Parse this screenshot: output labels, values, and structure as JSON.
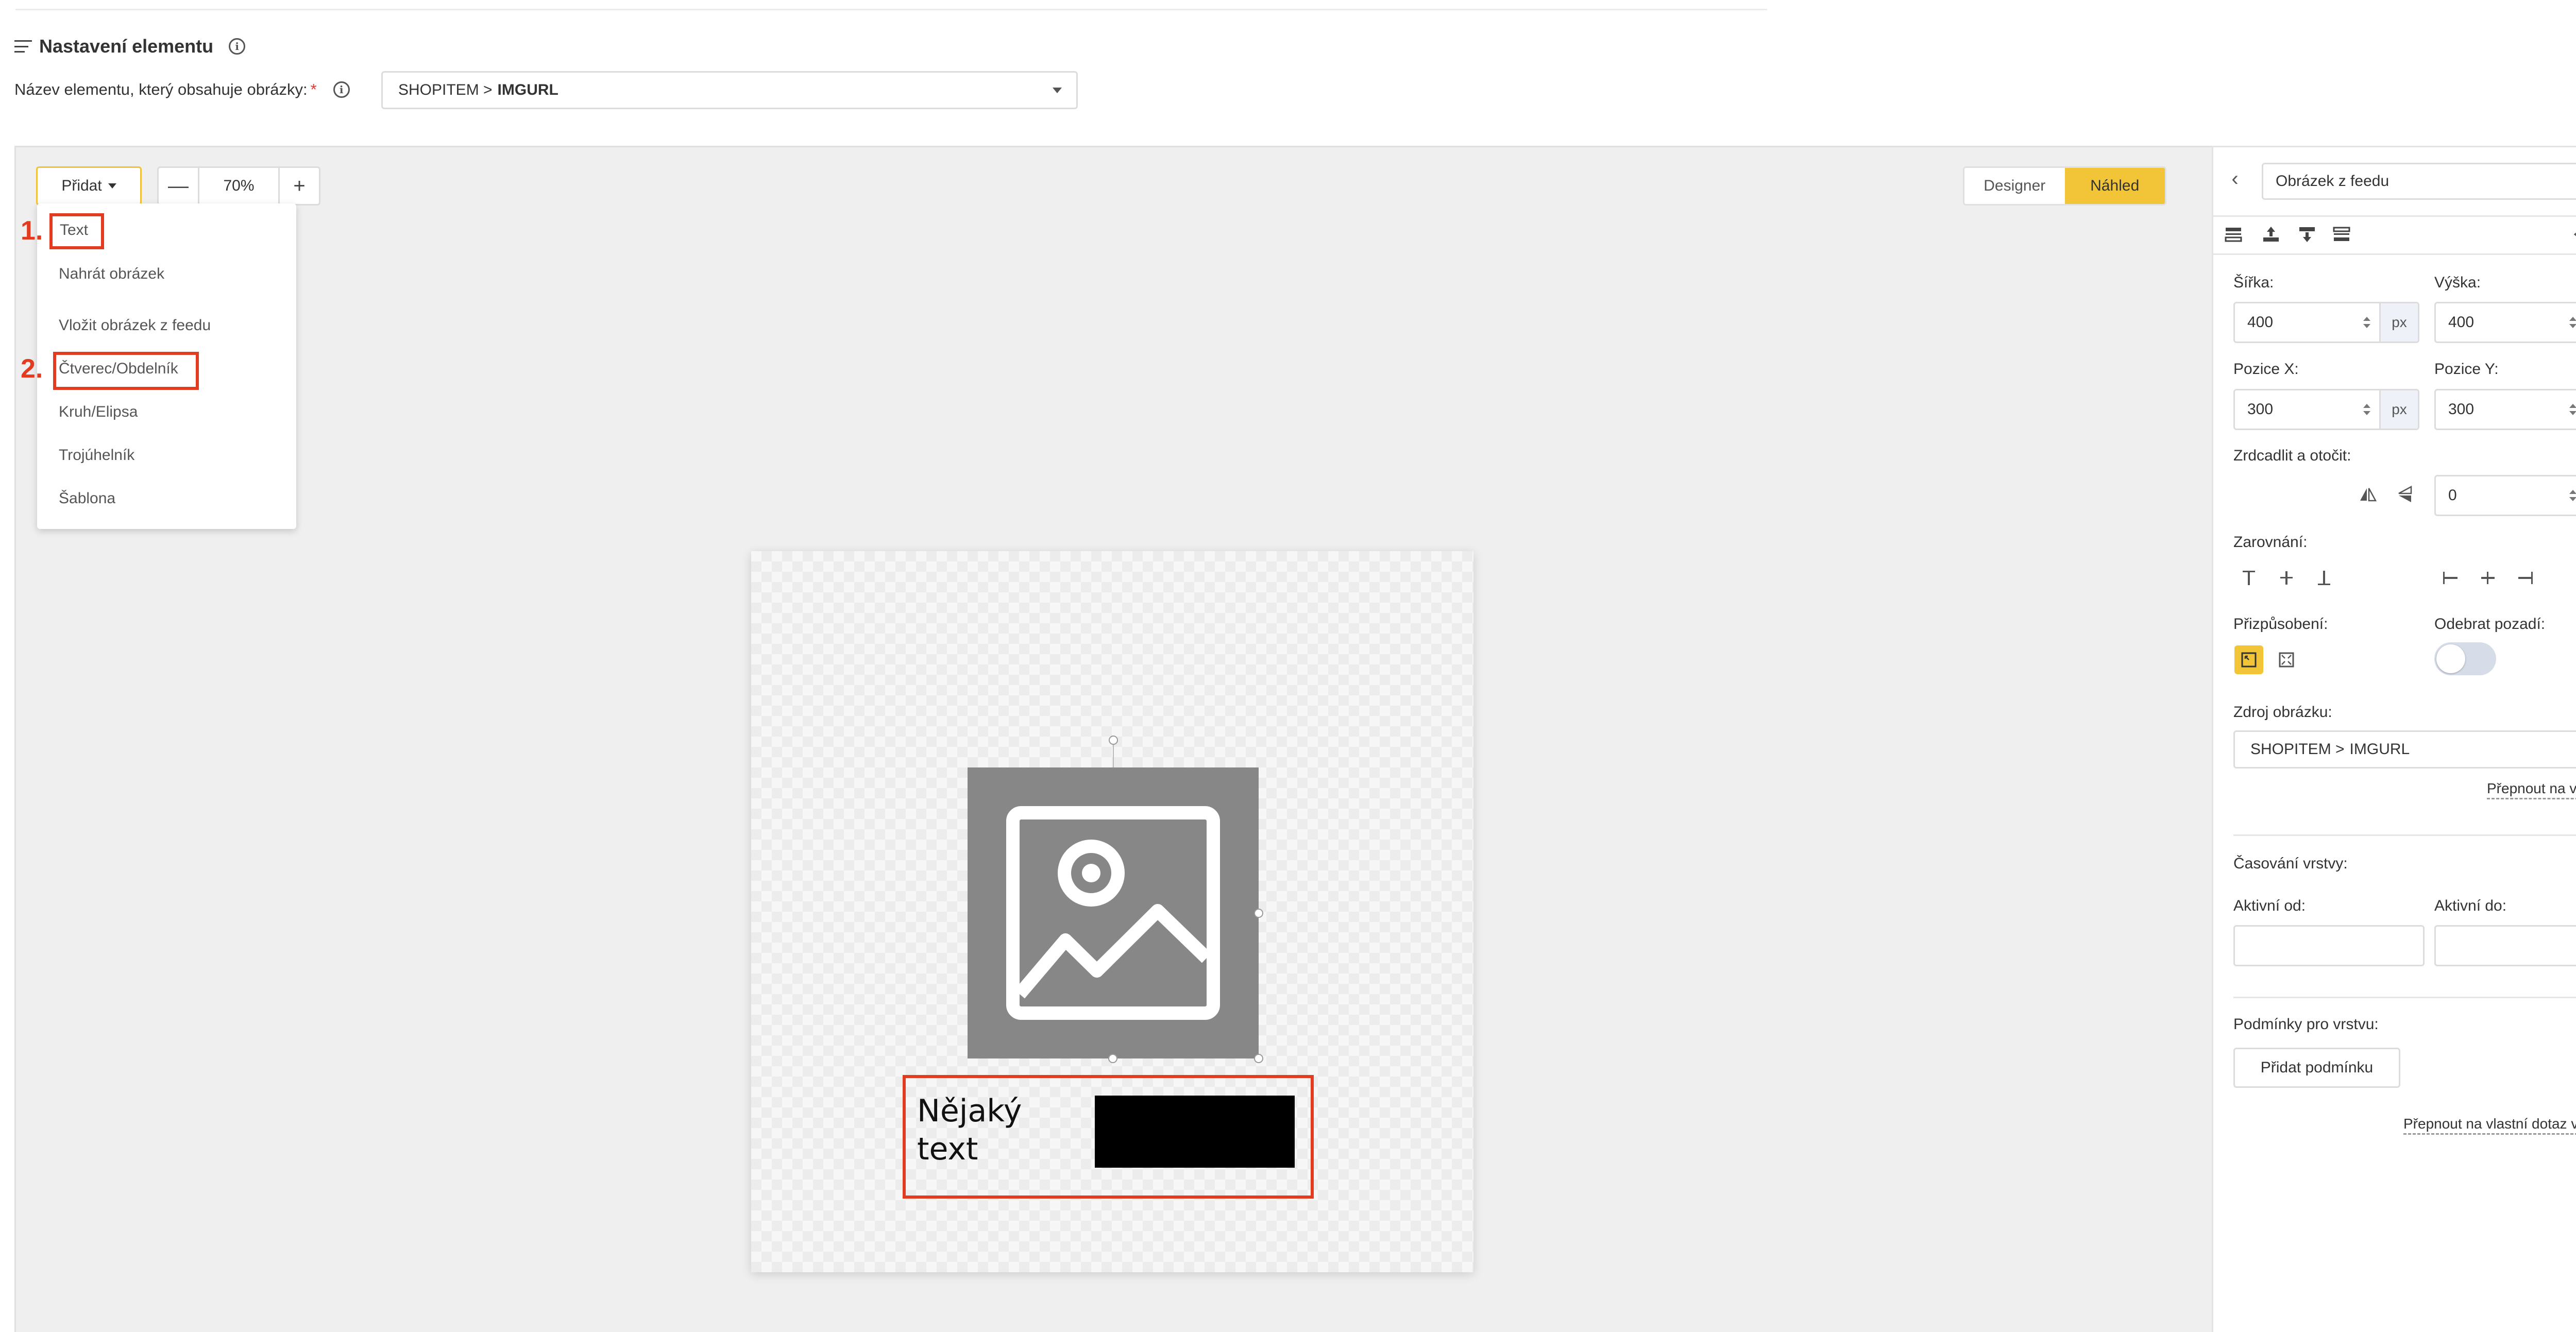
{
  "section": {
    "title": "Nastavení elementu",
    "info_icon": "info-icon"
  },
  "image_element": {
    "label": "Název elementu, který obsahuje obrázky:",
    "required_mark": "*",
    "source": "SHOPITEM >",
    "field": "IMGURL"
  },
  "toolbar": {
    "add_label": "Přidat",
    "zoom_out": "—",
    "zoom_value": "70%",
    "zoom_in": "+",
    "designer": "Designer",
    "preview": "Náhled"
  },
  "add_menu": {
    "items": [
      "Text",
      "Nahrát obrázek",
      "Vložit obrázek z feedu",
      "Čtverec/Obdelník",
      "Kruh/Elipsa",
      "Trojúhelník",
      "Šablona"
    ],
    "markers": [
      "1.",
      "2."
    ]
  },
  "canvas": {
    "sample_text_line1": "Nějaký",
    "sample_text_line2": "text",
    "image_placeholder_icon": "image-icon"
  },
  "panel": {
    "element_name": "Obrázek z feedu",
    "width_label": "Šířka:",
    "width_value": "400",
    "height_label": "Výška:",
    "height_value": "400",
    "pos_x_label": "Pozice X:",
    "pos_x_value": "300",
    "pos_y_label": "Pozice Y:",
    "pos_y_value": "300",
    "unit": "px",
    "mirror_label": "Zrdcadlit a otočit:",
    "rotate_value": "0",
    "rotate_unit": "°",
    "align_label": "Zarovnání:",
    "fit_label": "Přizpůsobení:",
    "remove_bg_label": "Odebrat pozadí:",
    "source_label": "Zdroj obrázku:",
    "source_prefix": "SHOPITEM >",
    "source_field": "IMGURL",
    "switch_own_link": "Přepnout na vlastní",
    "timing_title": "Časování vrstvy:",
    "active_from_label": "Aktivní od:",
    "active_to_label": "Aktivní do:",
    "conditions_title": "Podmínky pro vrstvu:",
    "add_condition": "Přidat podmínku",
    "fql_link": "Přepnout na vlastní dotaz v FQL"
  },
  "colors": {
    "accent": "#f2c437",
    "highlight": "#e33b20",
    "placeholder_gray": "#878787"
  }
}
